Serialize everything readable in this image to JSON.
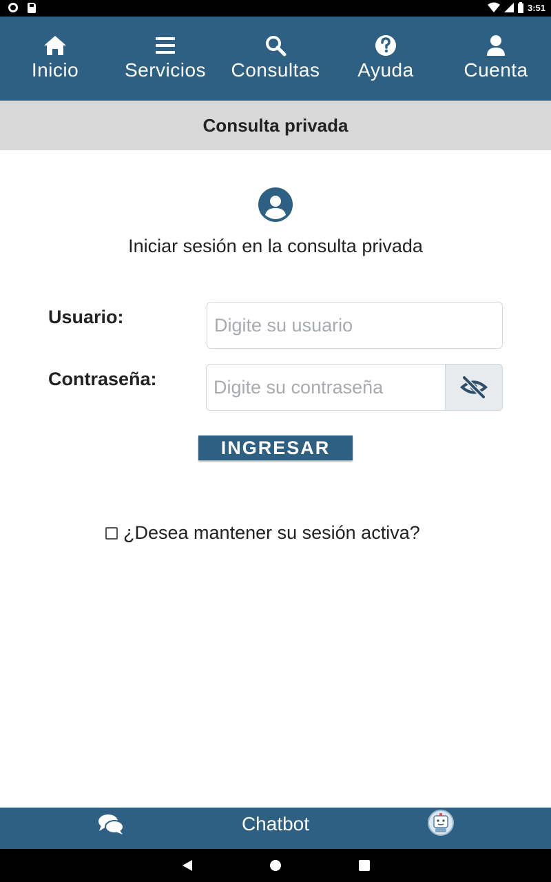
{
  "status_bar": {
    "time": "3:51"
  },
  "nav": {
    "items": [
      {
        "label": "Inicio",
        "icon": "home-icon"
      },
      {
        "label": "Servicios",
        "icon": "menu-icon"
      },
      {
        "label": "Consultas",
        "icon": "search-icon"
      },
      {
        "label": "Ayuda",
        "icon": "help-icon"
      },
      {
        "label": "Cuenta",
        "icon": "user-icon"
      }
    ]
  },
  "page": {
    "title": "Consulta privada"
  },
  "login": {
    "heading": "Iniciar sesión en la consulta privada",
    "user_label": "Usuario:",
    "user_placeholder": "Digite su usuario",
    "password_label": "Contraseña:",
    "password_placeholder": "Digite su contraseña",
    "submit_label": "INGRESAR",
    "keep_session_label": "¿Desea mantener su sesión activa?"
  },
  "chatbot": {
    "label": "Chatbot"
  },
  "colors": {
    "primary": "#2e6084",
    "band": "#d8d8d8"
  }
}
